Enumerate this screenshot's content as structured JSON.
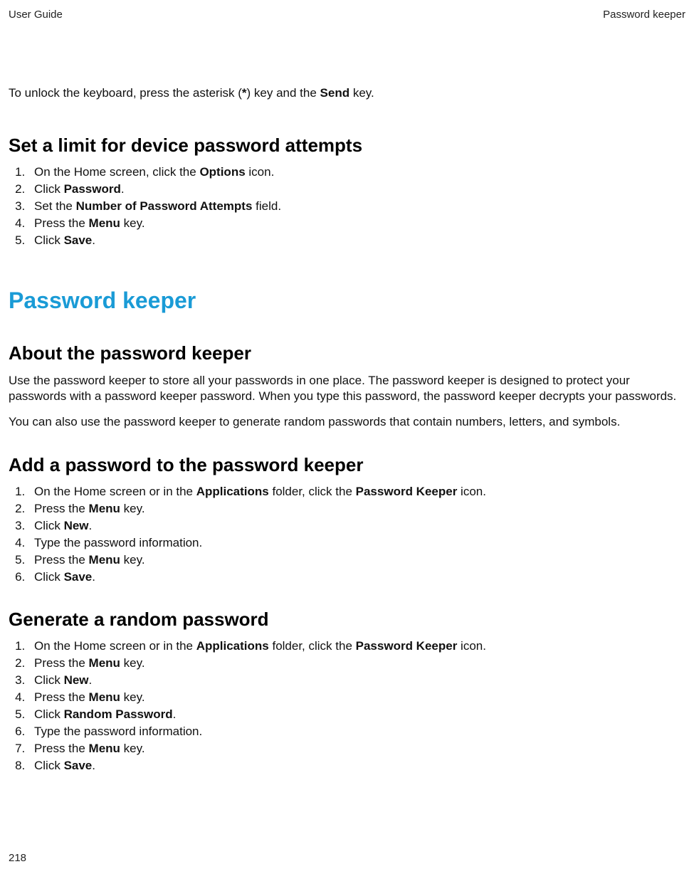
{
  "header": {
    "left": "User Guide",
    "right": "Password keeper"
  },
  "intro": {
    "pre": "To unlock the keyboard, press the asterisk (",
    "bold1": "*",
    "mid": ") key and the ",
    "bold2": "Send",
    "post": " key."
  },
  "sec_limit": {
    "title": "Set a limit for device password attempts",
    "steps": [
      {
        "pre": "On the Home screen, click the ",
        "b": "Options",
        "post": " icon."
      },
      {
        "pre": "Click ",
        "b": "Password",
        "post": "."
      },
      {
        "pre": "Set the ",
        "b": "Number of Password Attempts",
        "post": " field."
      },
      {
        "pre": "Press the ",
        "b": "Menu",
        "post": " key."
      },
      {
        "pre": "Click ",
        "b": "Save",
        "post": "."
      }
    ]
  },
  "major_title": "Password keeper",
  "sec_about": {
    "title": "About the password keeper",
    "p1": "Use the password keeper to store all your passwords in one place. The password keeper is designed to protect your passwords with a password keeper password. When you type this password, the password keeper decrypts your passwords.",
    "p2": "You can also use the password keeper to generate random passwords that contain numbers, letters, and symbols."
  },
  "sec_add": {
    "title": "Add a password to the password keeper",
    "steps": [
      {
        "pre": "On the Home screen or in the ",
        "b": "Applications",
        "mid": " folder, click the ",
        "b2": "Password Keeper",
        "post": " icon."
      },
      {
        "pre": "Press the ",
        "b": "Menu",
        "post": " key."
      },
      {
        "pre": "Click ",
        "b": "New",
        "post": "."
      },
      {
        "pre": "Type the password information.",
        "b": "",
        "post": ""
      },
      {
        "pre": "Press the ",
        "b": "Menu",
        "post": " key."
      },
      {
        "pre": "Click ",
        "b": "Save",
        "post": "."
      }
    ]
  },
  "sec_gen": {
    "title": "Generate a random password",
    "steps": [
      {
        "pre": "On the Home screen or in the ",
        "b": "Applications",
        "mid": " folder, click the ",
        "b2": "Password Keeper",
        "post": " icon."
      },
      {
        "pre": "Press the ",
        "b": "Menu",
        "post": " key."
      },
      {
        "pre": "Click ",
        "b": "New",
        "post": "."
      },
      {
        "pre": "Press the ",
        "b": "Menu",
        "post": " key."
      },
      {
        "pre": "Click ",
        "b": "Random Password",
        "post": "."
      },
      {
        "pre": "Type the password information.",
        "b": "",
        "post": ""
      },
      {
        "pre": "Press the ",
        "b": "Menu",
        "post": " key."
      },
      {
        "pre": "Click ",
        "b": "Save",
        "post": "."
      }
    ]
  },
  "page_number": "218"
}
